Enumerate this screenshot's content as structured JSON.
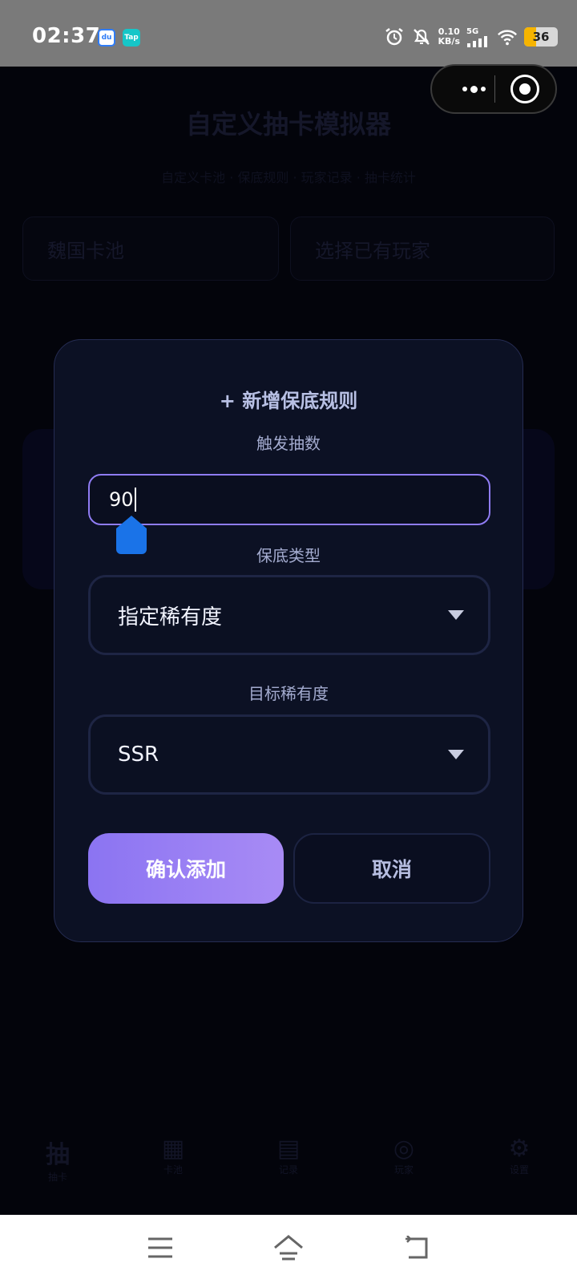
{
  "status_bar": {
    "time": "02:37",
    "app_badges": [
      "du",
      "Tap"
    ],
    "net_speed_value": "0.10",
    "net_speed_unit": "KB/s",
    "signal_label": "5G",
    "battery_percent": "36",
    "battery_level": 0.36,
    "battery_color": "#f6b400",
    "icons": [
      "alarm-icon",
      "mute-bell-icon",
      "signal-icon",
      "wifi-icon",
      "battery-icon"
    ]
  },
  "background": {
    "title": "自定义抽卡模拟器",
    "subtitle": "自定义卡池 · 保底规则 · 玩家记录 · 抽卡统计",
    "pool_select": "魏国卡池",
    "player_select": "选择已有玩家",
    "nav": [
      "抽卡",
      "卡池",
      "记录",
      "玩家",
      "设置"
    ]
  },
  "modal": {
    "title": "+ 新增保底规则",
    "trigger_label": "触发抽数",
    "trigger_value": "90",
    "type_label": "保底类型",
    "type_value": "指定稀有度",
    "rarity_label": "目标稀有度",
    "rarity_value": "SSR",
    "confirm_label": "确认添加",
    "cancel_label": "取消"
  },
  "colors": {
    "accent": "#8f7cf3",
    "confirm_gradient_start": "#8b74f2",
    "confirm_gradient_end": "#a88bf5",
    "modal_bg": "#0c1124",
    "cursor_handle": "#1a73e8"
  }
}
